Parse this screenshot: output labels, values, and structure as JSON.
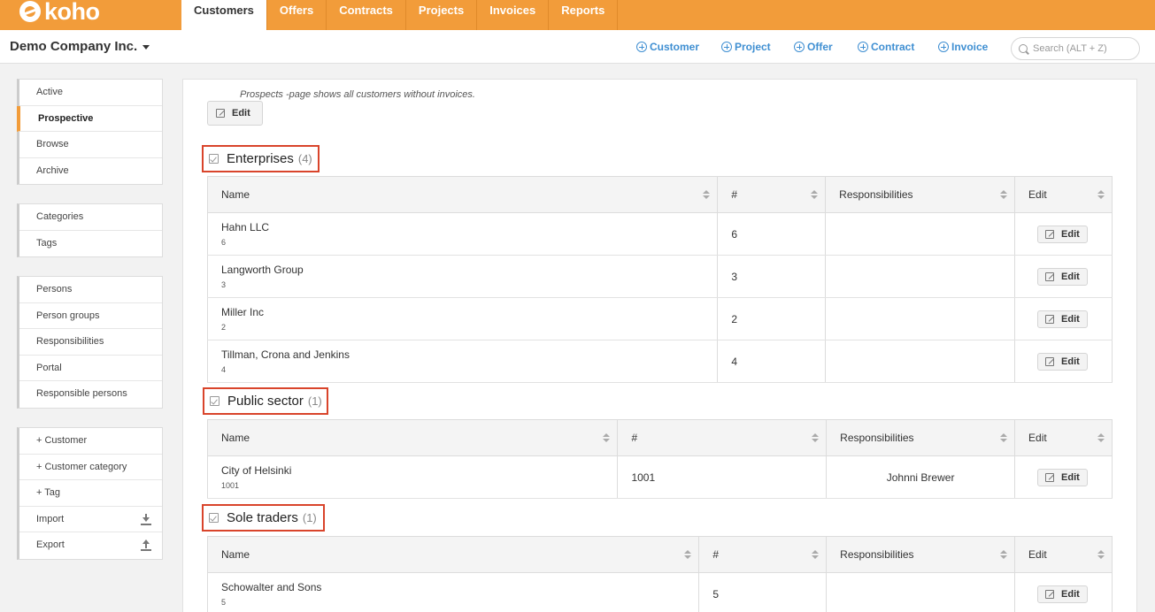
{
  "app": {
    "logo_text": "koho"
  },
  "nav": {
    "tabs": [
      {
        "label": "Customers"
      },
      {
        "label": "Offers"
      },
      {
        "label": "Contracts"
      },
      {
        "label": "Projects"
      },
      {
        "label": "Invoices"
      },
      {
        "label": "Reports"
      }
    ]
  },
  "header": {
    "company": "Demo Company Inc.",
    "quick_actions": [
      "Customer",
      "Project",
      "Offer",
      "Contract",
      "Invoice"
    ],
    "search_placeholder": "Search (ALT + Z)"
  },
  "sidebar": {
    "group1": [
      "Active",
      "Prospective",
      "Browse",
      "Archive"
    ],
    "group2": [
      "Categories",
      "Tags"
    ],
    "group3": [
      "Persons",
      "Person groups",
      "Responsibilities",
      "Portal",
      "Responsible persons"
    ],
    "group4": [
      "+ Customer",
      "+ Customer category",
      "+ Tag",
      "Import",
      "Export"
    ]
  },
  "main": {
    "note": "Prospects -page shows all customers without invoices.",
    "edit_label": "Edit",
    "columns": [
      "Name",
      "#",
      "Responsibilities",
      "Edit"
    ],
    "groups": [
      {
        "title": "Enterprises",
        "count": "(4)",
        "rows": [
          {
            "name": "Hahn LLC",
            "sub": "6",
            "num": "6",
            "resp": ""
          },
          {
            "name": "Langworth Group",
            "sub": "3",
            "num": "3",
            "resp": ""
          },
          {
            "name": "Miller Inc",
            "sub": "2",
            "num": "2",
            "resp": ""
          },
          {
            "name": "Tillman, Crona and Jenkins",
            "sub": "4",
            "num": "4",
            "resp": ""
          }
        ]
      },
      {
        "title": "Public sector",
        "count": "(1)",
        "rows": [
          {
            "name": "City of Helsinki",
            "sub": "1001",
            "num": "1001",
            "resp": "Johnni Brewer"
          }
        ]
      },
      {
        "title": "Sole traders",
        "count": "(1)",
        "rows": [
          {
            "name": "Schowalter and Sons",
            "sub": "5",
            "num": "5",
            "resp": ""
          }
        ]
      }
    ]
  }
}
